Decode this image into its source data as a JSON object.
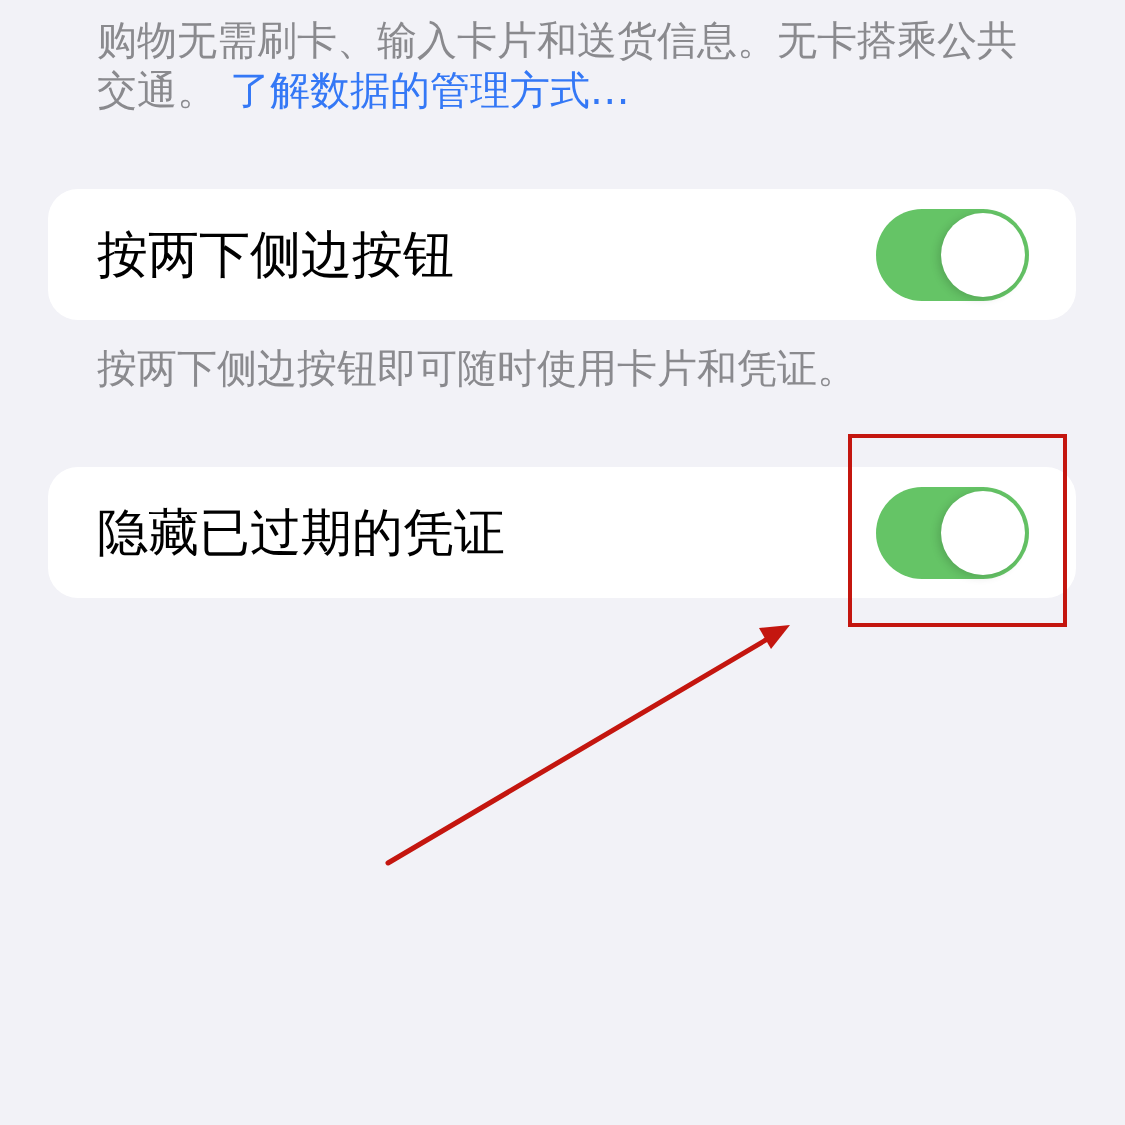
{
  "intro": {
    "text": "购物无需刷卡、输入卡片和送货信息。无卡搭乘公共交通。",
    "link": "了解数据的管理方式…"
  },
  "sections": [
    {
      "label": "按两下侧边按钮",
      "on": true,
      "highlighted": false,
      "footer": "按两下侧边按钮即可随时使用卡片和凭证。"
    },
    {
      "label": "隐藏已过期的凭证",
      "on": true,
      "highlighted": true
    }
  ]
}
